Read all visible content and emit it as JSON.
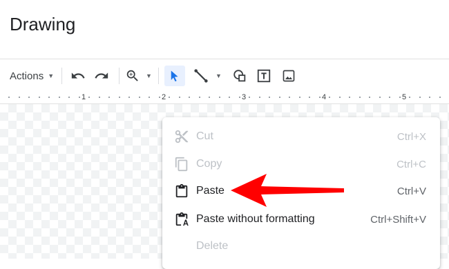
{
  "app": {
    "title": "Drawing"
  },
  "toolbar": {
    "actions_label": "Actions",
    "icons": [
      "undo-icon",
      "redo-icon",
      "zoom-icon",
      "select-icon",
      "line-icon",
      "shape-icon",
      "textbox-icon",
      "image-icon"
    ]
  },
  "ruler": {
    "marks": [
      "1",
      "2",
      "3",
      "4",
      "5"
    ]
  },
  "context_menu": {
    "items": [
      {
        "label": "Cut",
        "shortcut": "Ctrl+X",
        "icon": "scissors-icon",
        "enabled": false
      },
      {
        "label": "Copy",
        "shortcut": "Ctrl+C",
        "icon": "copy-icon",
        "enabled": false
      },
      {
        "label": "Paste",
        "shortcut": "Ctrl+V",
        "icon": "clipboard-icon",
        "enabled": true
      },
      {
        "label": "Paste without formatting",
        "shortcut": "Ctrl+Shift+V",
        "icon": "clipboard-text-icon",
        "enabled": true
      },
      {
        "label": "Delete",
        "shortcut": "",
        "icon": "",
        "enabled": false
      }
    ]
  },
  "colors": {
    "accent": "#1a73e8",
    "arrow": "#ff0000",
    "disabled_text": "#bdc1c6"
  }
}
